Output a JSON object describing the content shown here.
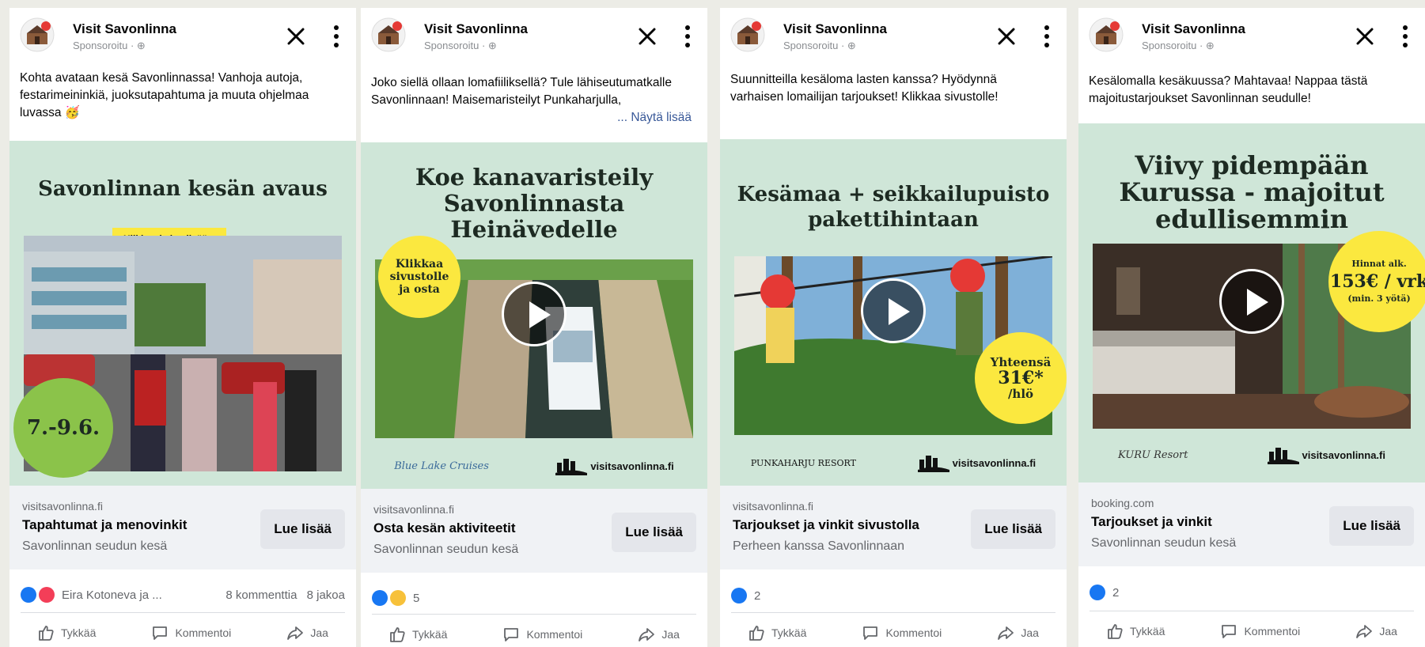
{
  "colors": {
    "creative_bg": "#cfe6d8",
    "badge_green": "#8bc34a",
    "badge_yellow": "#fbe83f",
    "cta_yellow": "#fbe83f",
    "like_blue": "#1877f2"
  },
  "common": {
    "page_name": "Visit Savonlinna",
    "sponsored": "Sponsoroitu · ⊕",
    "action_like": "Tykkää",
    "action_comment": "Kommentoi",
    "action_share": "Jaa"
  },
  "ads": [
    {
      "text": "Kohta avataan kesä Savonlinnassa! Vanhoja autoja, festarimeininkiä, juoksutapahtuma ja muuta ohjelmaa luvassa 🥳",
      "headline": "Savonlinnan kesän avaus",
      "cta_tag": "Klikkaa ja lue lisää »",
      "badge": "7.-9.6.",
      "domain": "visitsavonlinna.fi",
      "link_title": "Tapahtumat ja menovinkit",
      "link_sub": "Savonlinnan seudun kesä",
      "cta": "Lue lisää",
      "reactions": "Eira Kotoneva ja ...",
      "comments": "8 kommenttia",
      "shares": "8 jakoa"
    },
    {
      "text": "Joko siellä ollaan lomafiiliksellä? Tule lähiseutumatkalle Savonlinnaan! Maisemaristeilyt Punkaharjulla,",
      "see_more": "... Näytä lisää",
      "headline_1": "Koe kanavaristeily",
      "headline_2": "Savonlinnasta",
      "headline_3": "Heinävedelle",
      "badge_1": "Klikkaa",
      "badge_2": "sivustolle",
      "badge_3": "ja osta",
      "partner": "Blue Lake Cruises",
      "logo": "visitsavonlinna.fi",
      "domain": "visitsavonlinna.fi",
      "link_title": "Osta kesän aktiviteetit",
      "link_sub": "Savonlinnan seudun kesä",
      "cta": "Lue lisää",
      "reactions": "5"
    },
    {
      "text": "Suunnitteilla kesäloma lasten kanssa? Hyödynnä varhaisen lomailijan tarjoukset! Klikkaa sivustolle!",
      "headline_1": "Kesämaa + seikkailupuisto",
      "headline_2": "pakettihintaan",
      "badge_1": "Yhteensä",
      "badge_2": "31€*",
      "badge_3": "/hlö",
      "partner": "PUNKAHARJU RESORT",
      "logo": "visitsavonlinna.fi",
      "domain": "visitsavonlinna.fi",
      "link_title": "Tarjoukset ja vinkit sivustolla",
      "link_sub": "Perheen kanssa Savonlinnaan",
      "cta": "Lue lisää",
      "reactions": "2"
    },
    {
      "text": "Kesälomalla kesäkuussa? Mahtavaa! Nappaa tästä majoitustarjoukset Savonlinnan seudulle!",
      "headline_1": "Viivy pidempään",
      "headline_2": "Kurussa - majoitut",
      "headline_3": "edullisemmin",
      "badge_1": "Hinnat alk.",
      "badge_2": "153€ / vrk",
      "badge_3": "(min. 3 yötä)",
      "partner": "KURU Resort",
      "logo": "visitsavonlinna.fi",
      "domain": "booking.com",
      "link_title": "Tarjoukset ja vinkit",
      "link_sub": "Savonlinnan seudun kesä",
      "cta": "Lue lisää",
      "reactions": "2"
    }
  ]
}
